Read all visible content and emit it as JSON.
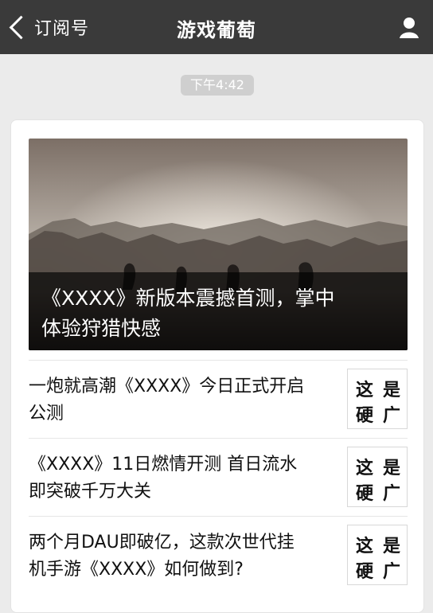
{
  "nav": {
    "back_label": "订阅号",
    "title": "游戏葡萄",
    "profile_icon": "person-icon"
  },
  "timestamp": "下午4:42",
  "feed": {
    "hero": {
      "title_line1": "《XXXX》新版本震撼首测，掌中",
      "title_line2": "体验狩猎快感"
    },
    "items": [
      {
        "title_line1": "一炮就高潮《XXXX》今日正式开启",
        "title_line2": "公测",
        "thumb_line1": "这是",
        "thumb_line2": "硬广"
      },
      {
        "title_line1": "《XXXX》11日燃情开测 首日流水",
        "title_line2": "即突破千万大关",
        "thumb_line1": "这是",
        "thumb_line2": "硬广"
      },
      {
        "title_line1": "两个月DAU即破亿，这款次世代挂",
        "title_line2": "机手游《XXXX》如何做到?",
        "thumb_line1": "这是",
        "thumb_line2": "硬广"
      }
    ]
  },
  "colors": {
    "topbar": "#3a3a3a",
    "background": "#ebebeb",
    "card": "#ffffff"
  }
}
